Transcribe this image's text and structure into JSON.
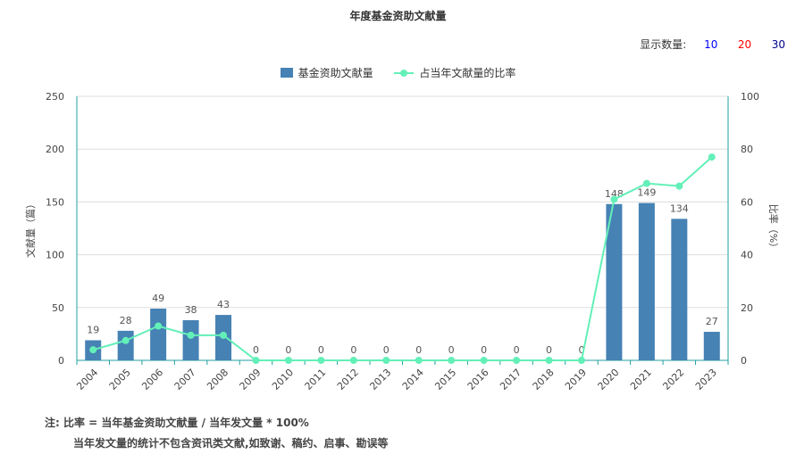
{
  "title": "年度基金资助文献量",
  "count_selector": {
    "label": "显示数量:",
    "options": [
      {
        "label": "10",
        "color": "#0000ff"
      },
      {
        "label": "20",
        "color": "#ff0000"
      },
      {
        "label": "30",
        "color": "#00008b"
      }
    ]
  },
  "legend": {
    "bar_label": "基金资助文献量",
    "line_label": "占当年文献量的比率"
  },
  "colors": {
    "bar": "#4682b4",
    "line": "#63f0b8",
    "axis": "#20a0a0",
    "grid": "#dddddd"
  },
  "chart_data": {
    "type": "bar",
    "title": "年度基金资助文献量",
    "categories": [
      "2004",
      "2005",
      "2006",
      "2007",
      "2008",
      "2009",
      "2010",
      "2011",
      "2012",
      "2013",
      "2014",
      "2015",
      "2016",
      "2017",
      "2018",
      "2019",
      "2020",
      "2021",
      "2022",
      "2023"
    ],
    "series": [
      {
        "name": "基金资助文献量",
        "type": "bar",
        "axis": "left",
        "values": [
          19,
          28,
          49,
          38,
          43,
          0,
          0,
          0,
          0,
          0,
          0,
          0,
          0,
          0,
          0,
          0,
          148,
          149,
          134,
          27
        ]
      },
      {
        "name": "占当年文献量的比率",
        "type": "line",
        "axis": "right",
        "values": [
          4,
          7.5,
          13,
          9.5,
          9.5,
          0,
          0,
          0,
          0,
          0,
          0,
          0,
          0,
          0,
          0,
          0,
          61,
          67,
          66,
          77
        ]
      }
    ],
    "ylabel": "文献量（篇）",
    "ylim": [
      0,
      250
    ],
    "yticks": [
      0,
      50,
      100,
      150,
      200,
      250
    ],
    "y2label": "比率（%）",
    "y2lim": [
      0,
      100
    ],
    "y2ticks": [
      0,
      20,
      40,
      60,
      80,
      100
    ],
    "grid": true,
    "legend_position": "top-center"
  },
  "notes": {
    "line1": "注:   比率 = 当年基金资助文献量 / 当年发文量 * 100%",
    "line2": "当年发文量的统计不包含资讯类文献,如致谢、稿约、启事、勘误等"
  }
}
